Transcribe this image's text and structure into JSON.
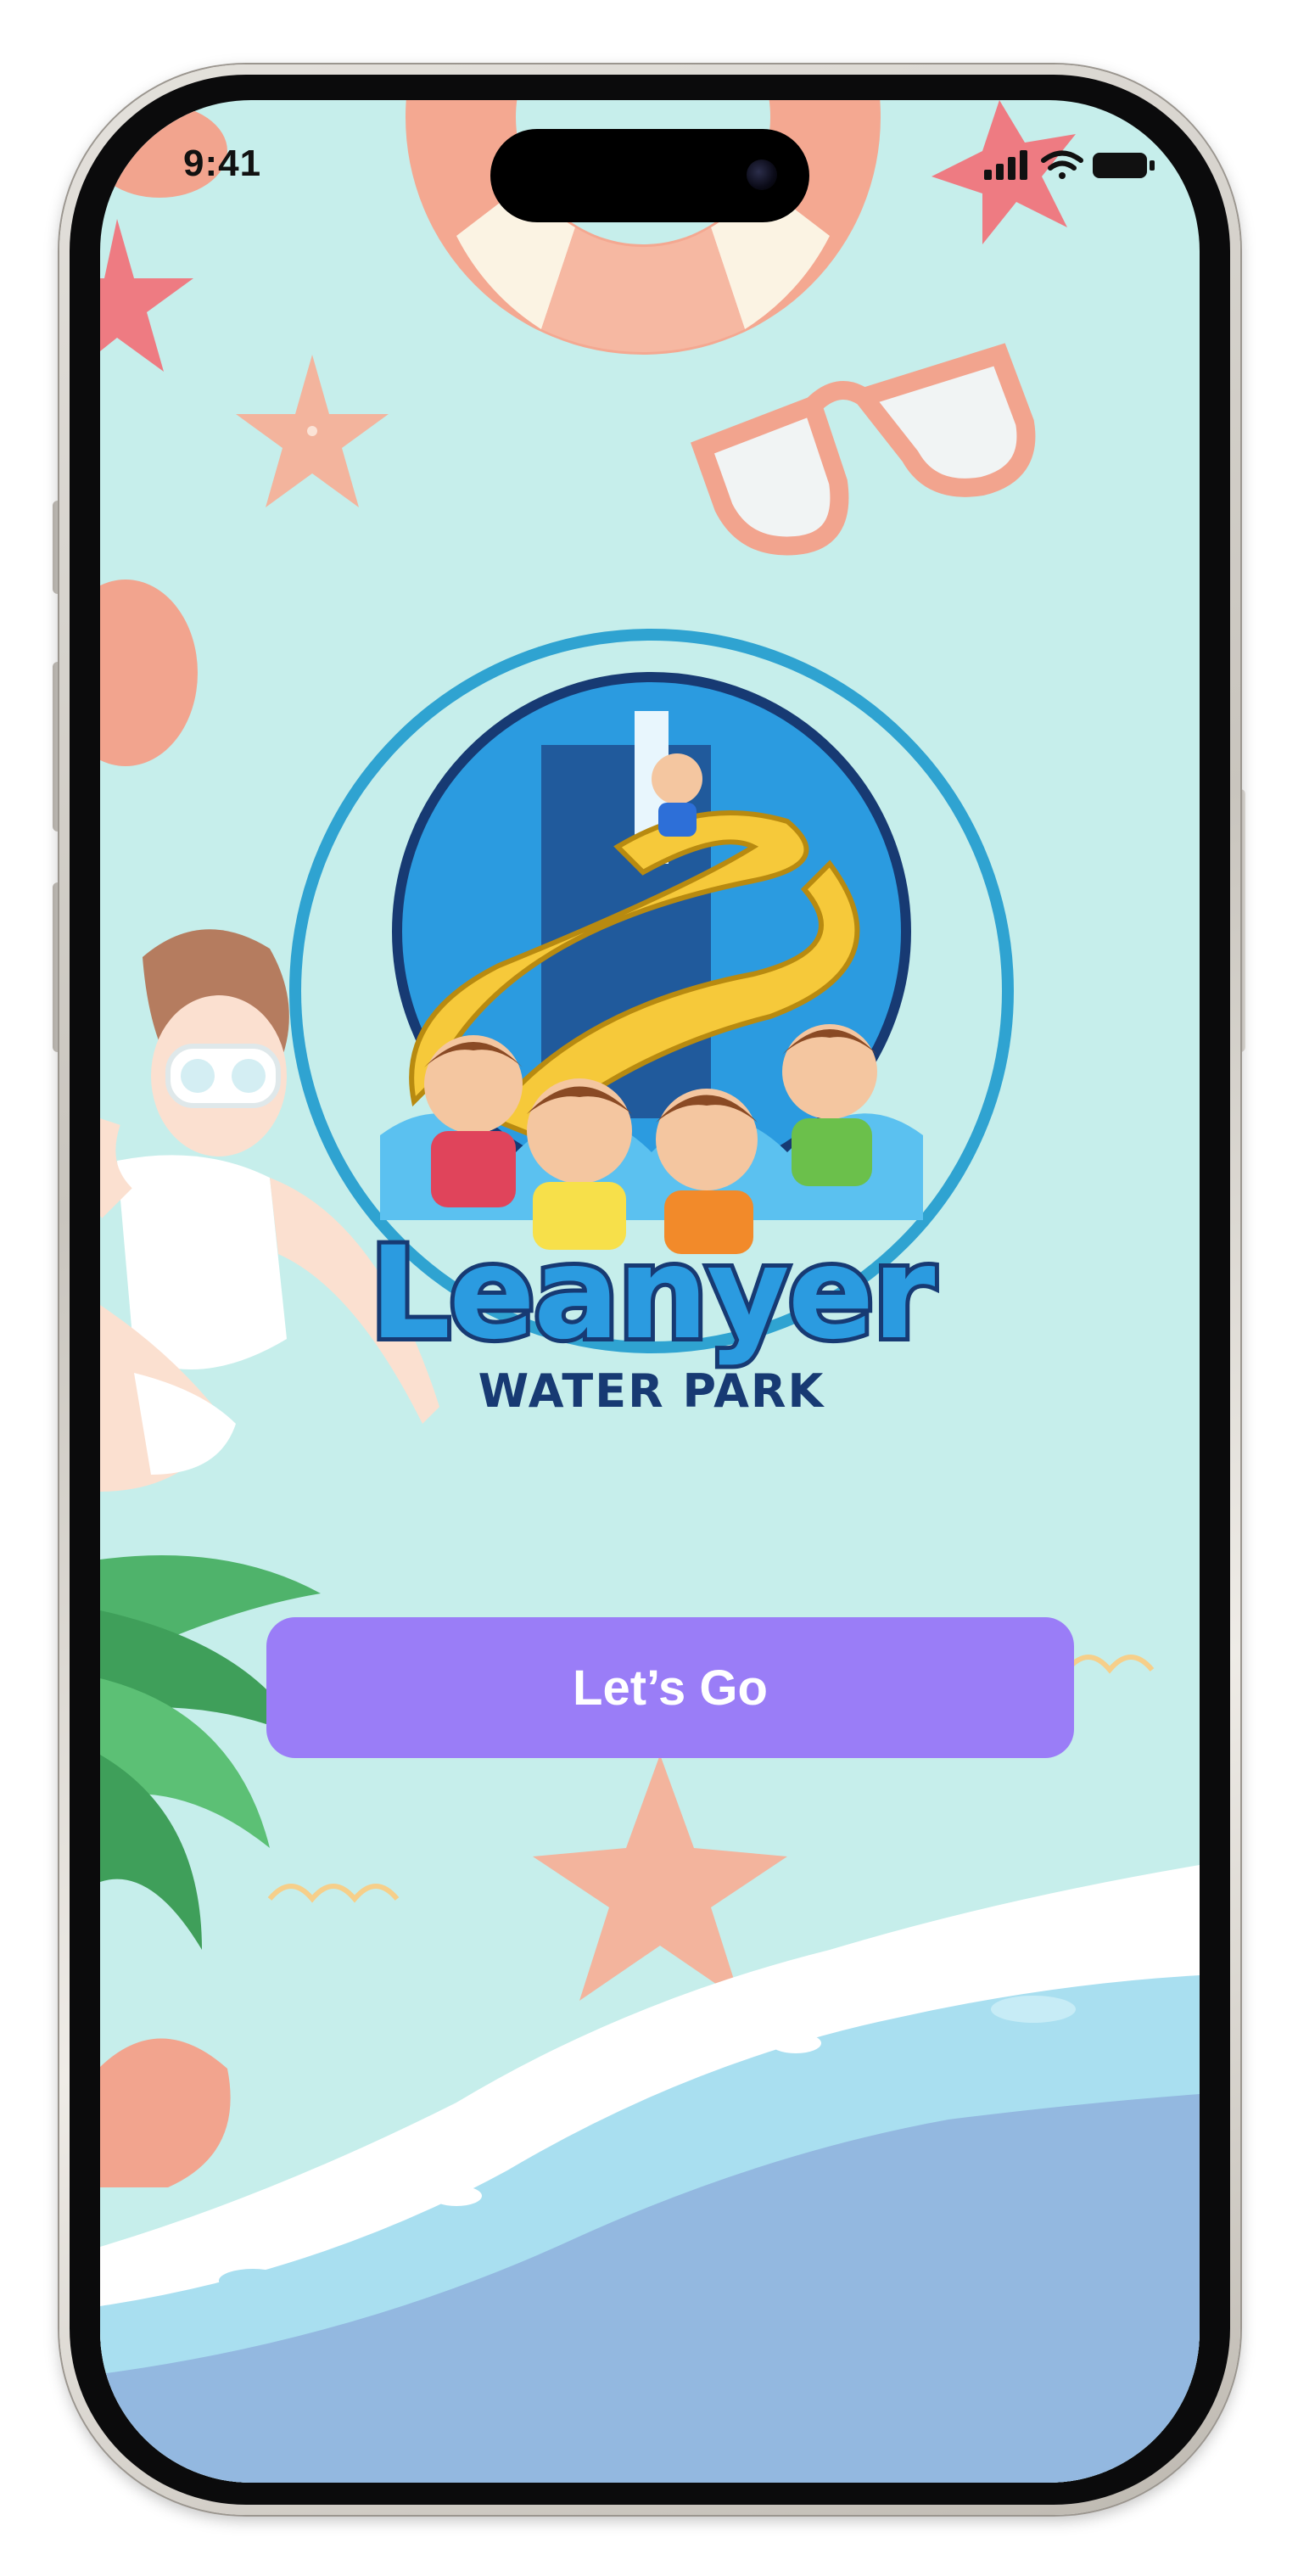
{
  "status_bar": {
    "time": "9:41",
    "icons": [
      "cellular-signal-icon",
      "wifi-icon",
      "battery-icon"
    ]
  },
  "logo": {
    "title": "Leanyer",
    "subtitle": "WATER PARK"
  },
  "cta": {
    "label": "Let’s Go"
  },
  "colors": {
    "background": "#c6eeeb",
    "button": "#9a7df7",
    "button_text": "#ffffff",
    "logo_title_fill": "#ffffff",
    "logo_outline": "#173a73",
    "water": "#93b8e0",
    "starfish": "#f3b49d"
  }
}
